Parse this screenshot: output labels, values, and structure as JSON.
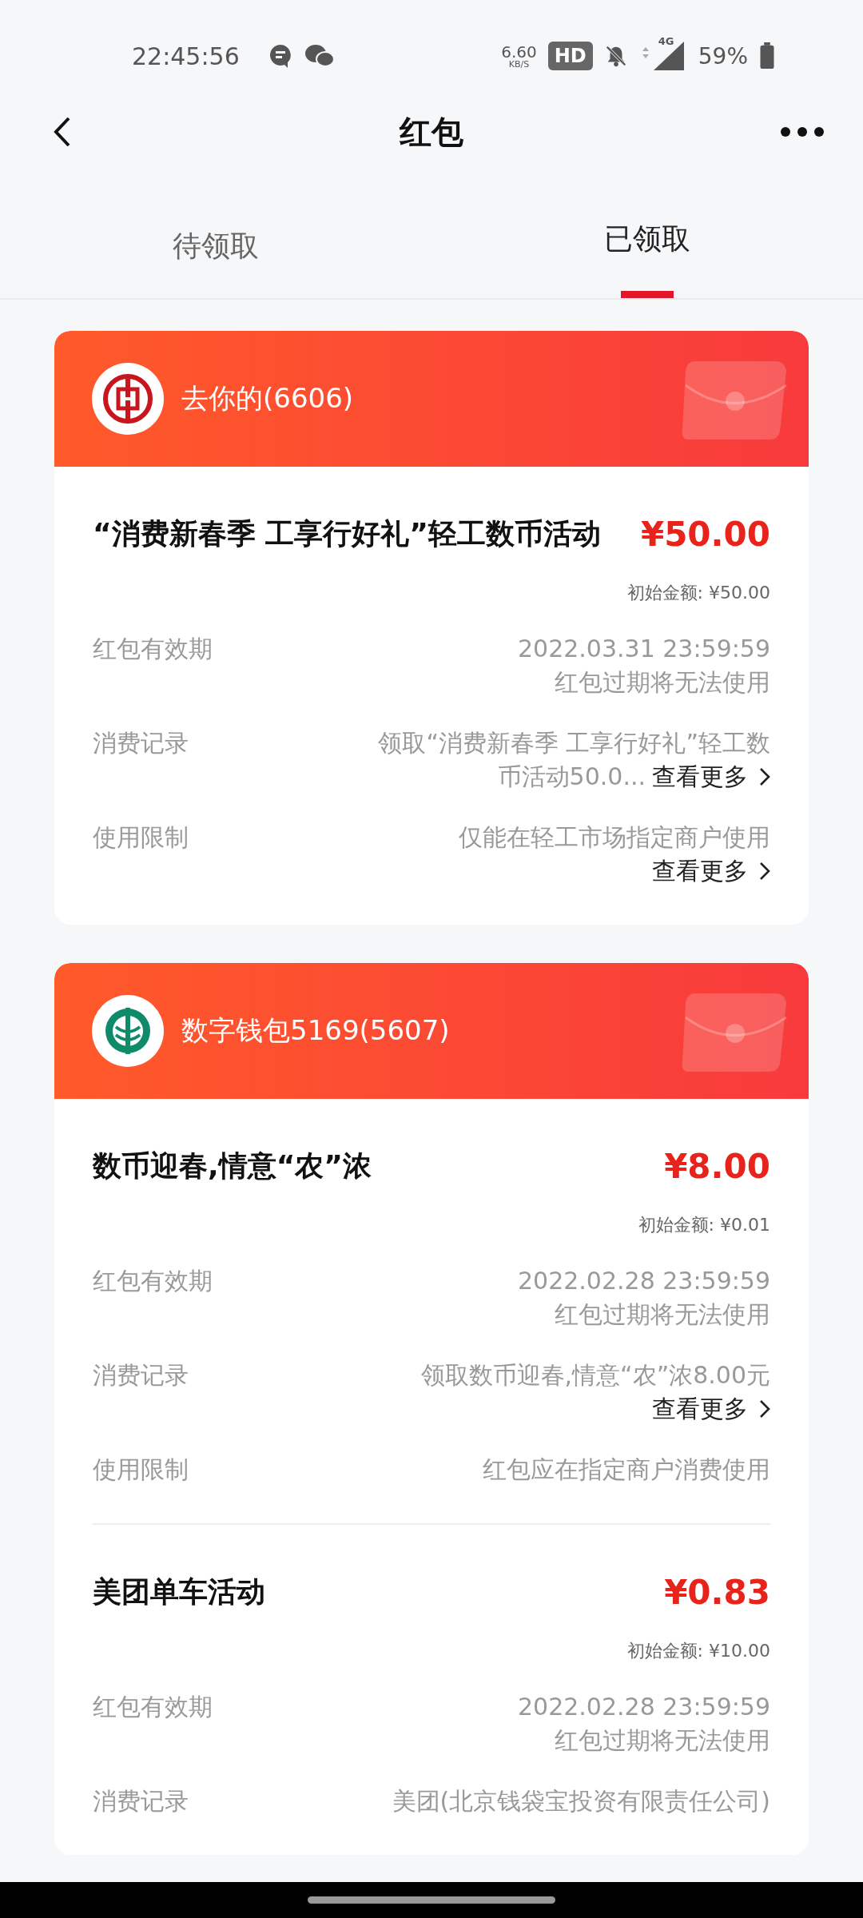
{
  "status_bar": {
    "time": "22:45:56",
    "speed": "6.60",
    "speed_unit": "KB/S",
    "hd": "HD",
    "network": "4G",
    "battery": "59%"
  },
  "header": {
    "title": "红包"
  },
  "tabs": [
    {
      "label": "待领取",
      "selected": false
    },
    {
      "label": "已领取",
      "selected": true
    }
  ],
  "cards": [
    {
      "bank": {
        "kind": "icbc",
        "account": "去你的(6606)"
      },
      "items": [
        {
          "title": "“消费新春季 工享行好礼”轻工数币活动",
          "amount": "¥50.00",
          "initial": "初始金额: ¥50.00",
          "rows": [
            {
              "label": "红包有效期",
              "lines": [
                {
                  "text": "2022.03.31 23:59:59"
                },
                {
                  "text": "红包过期将无法使用"
                }
              ]
            },
            {
              "label": "消费记录",
              "lines": [
                {
                  "text": "领取“消费新春季 工享行好礼”轻工数"
                },
                {
                  "text": "币活动50.0...",
                  "more": "查看更多"
                }
              ]
            },
            {
              "label": "使用限制",
              "lines": [
                {
                  "text": "仅能在轻工市场指定商户使用"
                },
                {
                  "more": "查看更多"
                }
              ]
            }
          ]
        }
      ]
    },
    {
      "bank": {
        "kind": "abc",
        "account": "数字钱包5169(5607)"
      },
      "items": [
        {
          "title": "数币迎春,情意“农”浓",
          "amount": "¥8.00",
          "initial": "初始金额: ¥0.01",
          "rows": [
            {
              "label": "红包有效期",
              "lines": [
                {
                  "text": "2022.02.28 23:59:59"
                },
                {
                  "text": "红包过期将无法使用"
                }
              ]
            },
            {
              "label": "消费记录",
              "lines": [
                {
                  "text": "领取数币迎春,情意“农”浓8.00元"
                },
                {
                  "more": "查看更多"
                }
              ]
            },
            {
              "label": "使用限制",
              "lines": [
                {
                  "text": "红包应在指定商户消费使用"
                }
              ]
            }
          ]
        },
        {
          "title": "美团单车活动",
          "amount": "¥0.83",
          "initial": "初始金额: ¥10.00",
          "rows": [
            {
              "label": "红包有效期",
              "lines": [
                {
                  "text": "2022.02.28 23:59:59"
                },
                {
                  "text": "红包过期将无法使用"
                }
              ]
            },
            {
              "label": "消费记录",
              "lines": [
                {
                  "text": "美团(北京钱袋宝投资有限责任公司)"
                }
              ]
            }
          ]
        }
      ]
    }
  ]
}
